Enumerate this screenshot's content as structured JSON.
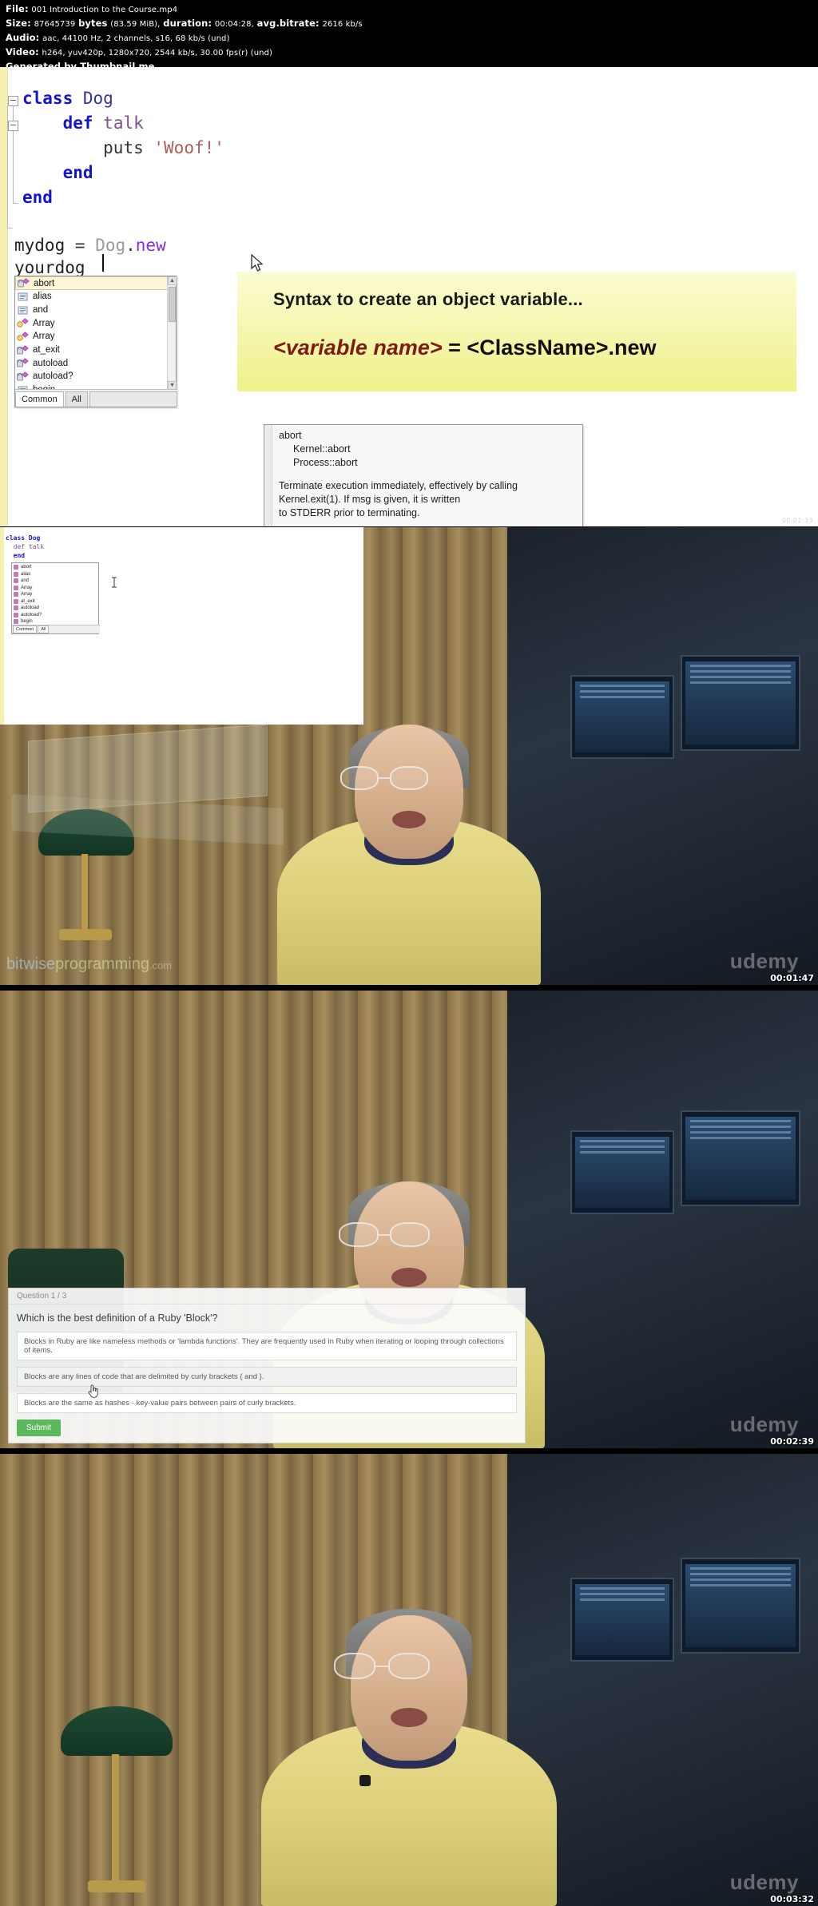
{
  "mediainfo": {
    "file_label": "File:",
    "file_name": "001 Introduction to the Course.mp4",
    "size_label": "Size:",
    "size_bytes": "87645739",
    "size_unit": "bytes",
    "size_human": "(83.59 MiB),",
    "duration_label": "duration:",
    "duration_value": "00:04:28,",
    "bitrate_label": "avg.bitrate:",
    "bitrate_value": "2616 kb/s",
    "audio_label": "Audio:",
    "audio_value": "aac, 44100 Hz, 2 channels, s16, 68 kb/s (und)",
    "video_label": "Video:",
    "video_value": "h264, yuv420p, 1280x720, 2544 kb/s, 30.00 fps(r) (und)",
    "generator": "Generated by Thumbnail me"
  },
  "ide": {
    "code": {
      "line1_kw": "class",
      "line1_name": "Dog",
      "line2_kw": "def",
      "line2_name": "talk",
      "line3_call": "puts",
      "line3_str": "'Woof!'",
      "line4_kw": "end",
      "line5_kw": "end",
      "line6_var": "mydog",
      "line6_eq": "=",
      "line6_recv": "Dog",
      "line6_dot": ".",
      "line6_new": "new",
      "line7_var": "yourdog"
    },
    "autocomplete": {
      "items": [
        {
          "label": "abort",
          "icon": "method-lock-icon",
          "selected": true
        },
        {
          "label": "alias",
          "icon": "keyword-icon",
          "selected": false
        },
        {
          "label": "and",
          "icon": "keyword-icon",
          "selected": false
        },
        {
          "label": "Array",
          "icon": "method-icon",
          "selected": false
        },
        {
          "label": "Array",
          "icon": "class-icon",
          "selected": false
        },
        {
          "label": "at_exit",
          "icon": "method-lock-icon",
          "selected": false
        },
        {
          "label": "autoload",
          "icon": "method-lock-icon",
          "selected": false
        },
        {
          "label": "autoload?",
          "icon": "method-lock-icon",
          "selected": false
        },
        {
          "label": "begin",
          "icon": "keyword-icon",
          "selected": false
        }
      ],
      "tabs": [
        {
          "label": "Common",
          "active": true
        },
        {
          "label": "All",
          "active": false
        }
      ]
    },
    "doc_popup": {
      "title": "abort",
      "sig1": "Kernel::abort",
      "sig2": "Process::abort",
      "body1": "Terminate execution immediately, effectively by calling",
      "body2": "Kernel.exit(1). If msg is given, it is written",
      "body3": "to STDERR prior to terminating."
    },
    "callout": {
      "heading": "Syntax to create an object variable...",
      "syntax_italic": "<variable name>",
      "syntax_eq": " = ",
      "syntax_class": "<ClassName>.new",
      "bg_from": "#fbfcd2",
      "bg_to": "#eff18a",
      "text_color": "#7d1b14"
    },
    "timestamp": "00:01:33"
  },
  "frames": [
    {
      "name": "frame-1",
      "timestamp": "00:01:47",
      "watermark": "udemy",
      "overlay_watermark": {
        "part1": "bitwise",
        "part2": "programming",
        "part3": ".com"
      },
      "inset": {
        "code_line1": "class Dog",
        "code_line2": "  def talk",
        "code_line3": "  end",
        "ac_items": [
          "abort",
          "alias",
          "and",
          "Array",
          "Array",
          "at_exit",
          "autoload",
          "autoload?",
          "begin"
        ],
        "ac_tabs": [
          "Common",
          "All"
        ]
      }
    },
    {
      "name": "frame-2",
      "timestamp": "00:02:39",
      "watermark": "udemy",
      "quiz": {
        "progress": "Question 1 / 3",
        "question": "Which is the best definition of a Ruby 'Block'?",
        "options": [
          "Blocks in Ruby are like nameless methods or 'lambda functions'. They are frequently used in Ruby when iterating or looping through collections of items.",
          "Blocks are any lines of code that are delimited by curly brackets { and }.",
          "Blocks are the same as hashes - key-value pairs between pairs of curly brackets."
        ],
        "highlighted_index": 1,
        "submit_label": "Submit",
        "submit_color": "#5cb85c"
      }
    },
    {
      "name": "frame-3",
      "timestamp": "00:03:32",
      "watermark": "udemy"
    }
  ]
}
